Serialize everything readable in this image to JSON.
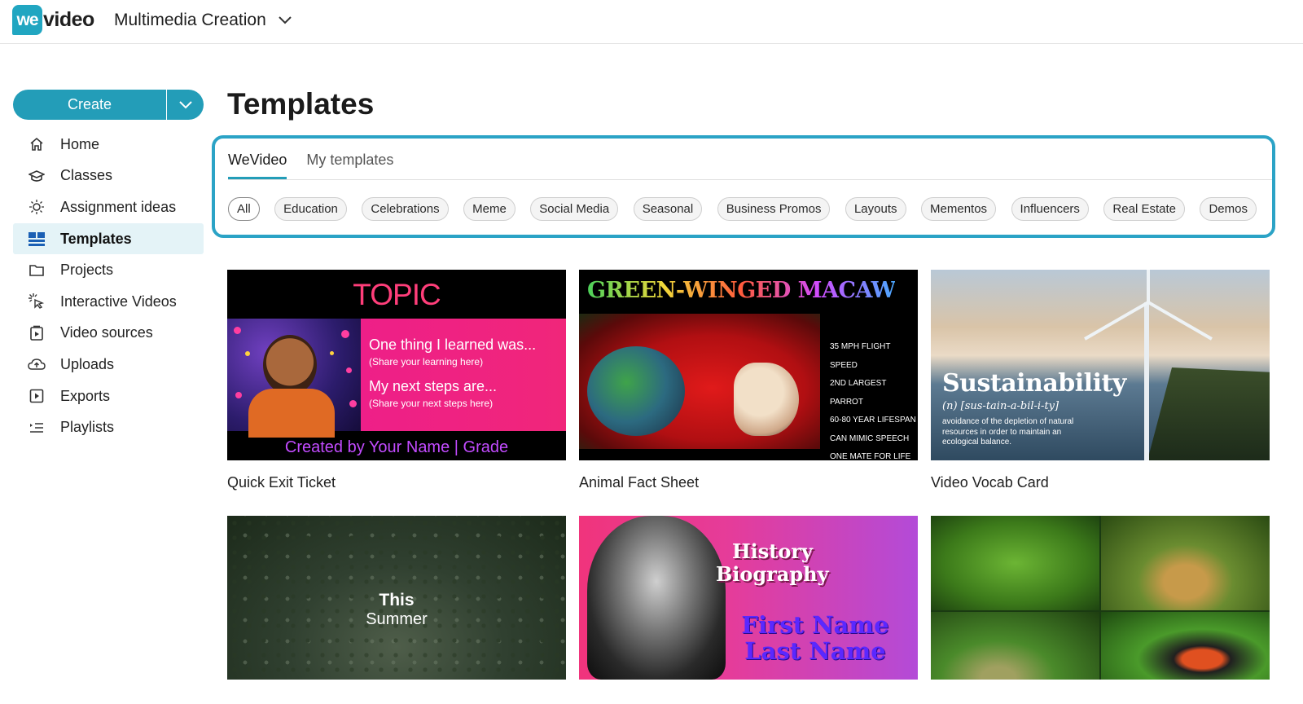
{
  "header": {
    "logo_badge": "we",
    "logo_rest": "video",
    "workspace": "Multimedia Creation"
  },
  "sidebar": {
    "create_label": "Create",
    "items": [
      {
        "label": "Home",
        "icon": "home-icon"
      },
      {
        "label": "Classes",
        "icon": "classes-icon"
      },
      {
        "label": "Assignment ideas",
        "icon": "lightbulb-icon"
      },
      {
        "label": "Templates",
        "icon": "templates-icon",
        "active": true
      },
      {
        "label": "Projects",
        "icon": "folder-icon"
      },
      {
        "label": "Interactive Videos",
        "icon": "interactive-cursor-icon"
      },
      {
        "label": "Video sources",
        "icon": "video-sources-icon"
      },
      {
        "label": "Uploads",
        "icon": "upload-cloud-icon"
      },
      {
        "label": "Exports",
        "icon": "export-icon"
      },
      {
        "label": "Playlists",
        "icon": "playlist-icon"
      }
    ]
  },
  "main": {
    "title": "Templates",
    "tabs": [
      {
        "label": "WeVideo",
        "active": true
      },
      {
        "label": "My templates",
        "active": false
      }
    ],
    "categories": [
      "All",
      "Education",
      "Celebrations",
      "Meme",
      "Social Media",
      "Seasonal",
      "Business Promos",
      "Layouts",
      "Mementos",
      "Influencers",
      "Real Estate",
      "Demos"
    ],
    "selected_category": "All",
    "highlight_color": "#2ba3c6",
    "accent_color": "#239db8"
  },
  "templates": [
    {
      "title": "Quick Exit Ticket",
      "thumb": {
        "topic": "TOPIC",
        "line1": "One thing I learned was...",
        "sub1": "(Share your learning here)",
        "line2": "My next steps are...",
        "sub2": "(Share your next steps here)",
        "footer": "Created by Your Name | Grade"
      }
    },
    {
      "title": "Animal Fact Sheet",
      "thumb": {
        "heading": "GREEN-WINGED MACAW",
        "facts": [
          "35 MPH FLIGHT SPEED",
          "2ND LARGEST PARROT",
          "60-80 YEAR LIFESPAN",
          "CAN MIMIC SPEECH",
          "ONE MATE FOR LIFE"
        ]
      }
    },
    {
      "title": "Video Vocab Card",
      "thumb": {
        "word": "Sustainability",
        "pronunciation": "(n) [sus-tain-a-bil-i-ty]",
        "definition": "avoidance of the depletion of natural resources in order to maintain an ecological balance."
      }
    },
    {
      "title": "",
      "thumb": {
        "line1": "This",
        "line2": "Summer"
      }
    },
    {
      "title": "",
      "thumb": {
        "line1": "History",
        "line2": "Biography",
        "name1": "First Name",
        "name2": "Last Name"
      }
    },
    {
      "title": "",
      "thumb": {}
    }
  ]
}
